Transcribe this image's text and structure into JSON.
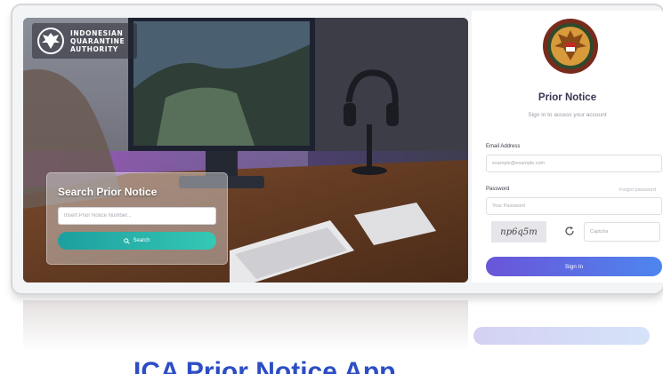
{
  "brand": {
    "line1": "INDONESIAN",
    "line2": "QUARANTINE",
    "line3": "AUTHORITY",
    "emblem_icon": "garuda-emblem-icon"
  },
  "search": {
    "title": "Search Prior Notice",
    "placeholder": "Insert Prior Notice Number...",
    "button_label": "Search",
    "button_icon": "search-icon"
  },
  "login": {
    "seal_icon": "badan-karantina-seal-icon",
    "title": "Prior Notice",
    "subtitle": "Sign in to access your account",
    "email_label": "Email Address",
    "email_placeholder": "example@example.com",
    "password_label": "Password",
    "forgot_label": "Forgot password",
    "password_placeholder": "Your Password",
    "captcha_text": "np6q5m",
    "captcha_placeholder": "Captcha",
    "refresh_icon": "refresh-icon",
    "signin_label": "Sign In"
  },
  "caption": "ICA Prior Notice App",
  "colors": {
    "search_button": "#2bb5aa",
    "signin_start": "#6a55d8",
    "signin_end": "#4e86ee",
    "title_text": "#3b3550",
    "caption_text": "#2c4dc4"
  }
}
